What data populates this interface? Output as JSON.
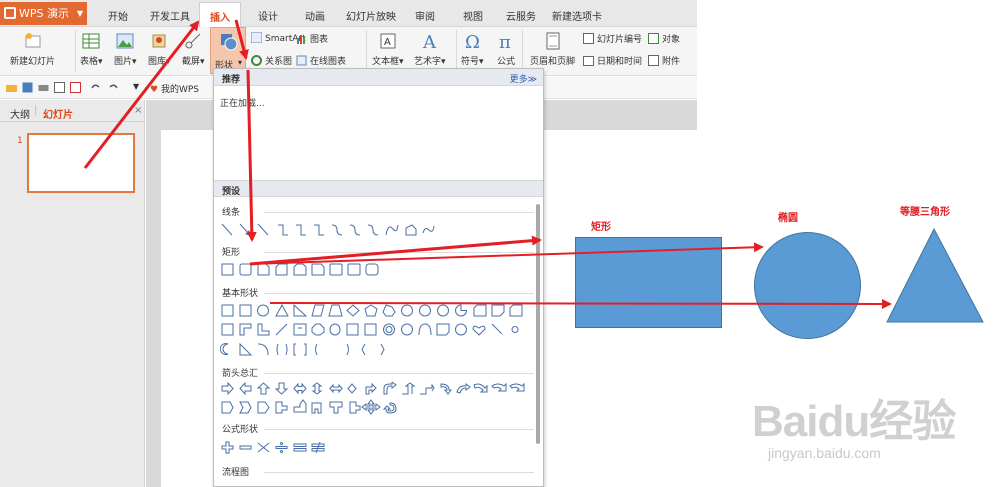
{
  "app": {
    "name": "WPS 演示",
    "tabs": [
      "开始",
      "开发工具",
      "插入",
      "设计",
      "动画",
      "幻灯片放映",
      "审阅",
      "视图",
      "云服务",
      "新建选项卡"
    ],
    "active_tab": "插入"
  },
  "ribbon": {
    "new_slide": "新建幻灯片",
    "table": "表格",
    "picture": "图片",
    "gallery": "图库",
    "screenshot": "截屏",
    "shape": "形状",
    "smartart": "SmartArt",
    "chart": "图表",
    "relation": "关系图",
    "online_chart": "在线图表",
    "textbox": "文本框",
    "wordart": "艺术字",
    "symbol": "符号",
    "formula": "公式",
    "header_footer": "页眉和页脚",
    "slide_number": "幻灯片编号",
    "object": "对象",
    "date_time": "日期和时间",
    "attachment": "附件"
  },
  "quickbar": {
    "mywps": "我的WPS"
  },
  "left_panel": {
    "tab_outline": "大纲",
    "tab_slides": "幻灯片",
    "slide_number": "1"
  },
  "shapes_dropdown": {
    "recommended": "推荐",
    "more": "更多≫",
    "loading": "正在加载...",
    "preset": "预设",
    "categories": {
      "lines": "线条",
      "rectangles": "矩形",
      "basic": "基本形状",
      "arrows": "箭头总汇",
      "equation": "公式形状",
      "flowchart": "流程图"
    }
  },
  "annotations": {
    "rectangle": "矩形",
    "ellipse": "椭圆",
    "triangle": "等腰三角形"
  },
  "watermark": {
    "brand": "Baidu经验",
    "url": "jingyan.baidu.com"
  },
  "colors": {
    "accent": "#e2692f",
    "shape_fill": "#5b9bd5",
    "annotation": "#e31e24"
  }
}
